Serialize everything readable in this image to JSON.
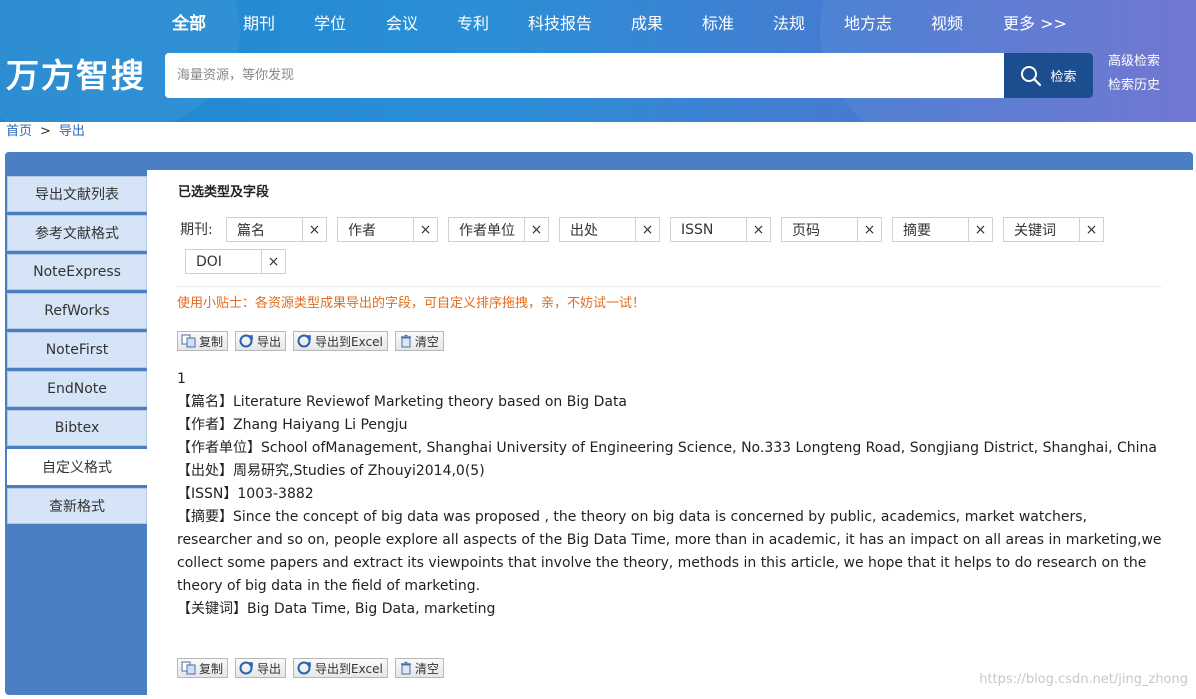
{
  "nav": {
    "items": [
      "全部",
      "期刊",
      "学位",
      "会议",
      "专利",
      "科技报告",
      "成果",
      "标准",
      "法规",
      "地方志",
      "视频",
      "更多 >>"
    ]
  },
  "logo": "万方智搜",
  "search": {
    "placeholder": "海量资源，等你发现",
    "button_label": "检索"
  },
  "side_links": {
    "advanced": "高级检索",
    "history": "检索历史"
  },
  "breadcrumb": {
    "home": "首页",
    "separator": ">",
    "current": "导出"
  },
  "sidebar": {
    "items": [
      "导出文献列表",
      "参考文献格式",
      "NoteExpress",
      "RefWorks",
      "NoteFirst",
      "EndNote",
      "Bibtex",
      "自定义格式",
      "查新格式"
    ],
    "active_index": 7
  },
  "selection": {
    "title": "已选类型及字段",
    "type_label": "期刊:",
    "fields": [
      "篇名",
      "作者",
      "作者单位",
      "出处",
      "ISSN",
      "页码",
      "摘要",
      "关键词",
      "DOI"
    ],
    "remove_symbol": "×"
  },
  "tip": "使用小贴士：各资源类型成果导出的字段，可自定义排序拖拽，亲，不妨试一试！",
  "toolbar": {
    "copy": "复制",
    "export": "导出",
    "export_excel": "导出到Excel",
    "clear": "清空"
  },
  "record": {
    "index": "1",
    "title": "【篇名】Literature Reviewof Marketing theory based on Big Data",
    "authors": "【作者】Zhang Haiyang Li Pengju",
    "affiliation": "【作者单位】School ofManagement, Shanghai University of Engineering Science, No.333 Longteng Road, Songjiang District, Shanghai, China",
    "source": "【出处】周易研究,Studies of Zhouyi2014,0(5)",
    "issn": "【ISSN】1003-3882",
    "abstract": "【摘要】Since the concept of big data was proposed , the theory on big data is concerned by public, academics, market watchers, researcher and so on, people explore all aspects of the Big Data Time, more than in academic, it has an impact on all areas in marketing,we collect some papers and extract its viewpoints that involve the theory, methods in this article, we hope that it helps to do research on the theory of big data in the field of marketing.",
    "keywords": "【关键词】Big Data Time, Big Data, marketing"
  },
  "watermark": "https://blog.csdn.net/jing_zhong",
  "colors": {
    "header_gradient_start": "#1f86cf",
    "header_gradient_end": "#6a6fcf",
    "search_button": "#1c4e8f",
    "panel_blue": "#4a7fc4",
    "sidebar_item": "#d5e4f6",
    "tip_orange": "#e46b1c",
    "link_blue": "#2a6ab8"
  }
}
